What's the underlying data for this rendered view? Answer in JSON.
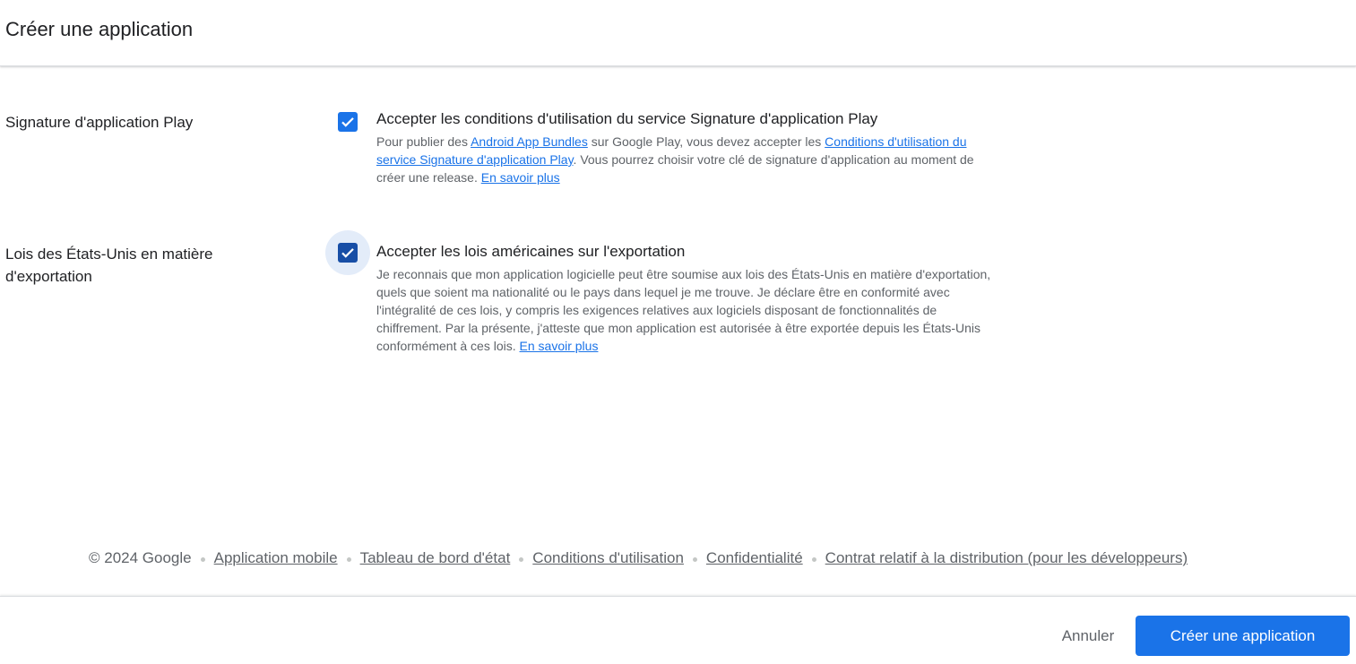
{
  "header": {
    "title": "Créer une application"
  },
  "sections": {
    "signing": {
      "label": "Signature d'application Play",
      "checked": true,
      "title": "Accepter les conditions d'utilisation du service Signature d'application Play",
      "desc_1": "Pour publier des ",
      "link_bundles": "Android App Bundles",
      "desc_2": " sur Google Play, vous devez accepter les ",
      "link_terms": "Conditions d'utilisation du service Signature d'application Play",
      "desc_3": ". Vous pourrez choisir votre clé de signature d'application au moment de créer une release. ",
      "link_learn": "En savoir plus"
    },
    "export": {
      "label": "Lois des États-Unis en matière d'exportation",
      "checked": true,
      "title": "Accepter les lois américaines sur l'exportation",
      "desc": "Je reconnais que mon application logicielle peut être soumise aux lois des États-Unis en matière d'exportation, quels que soient ma nationalité ou le pays dans lequel je me trouve. Je déclare être en conformité avec l'intégralité de ces lois, y compris les exigences relatives aux logiciels disposant de fonctionnalités de chiffrement. Par la présente, j'atteste que mon application est autorisée à être exportée depuis les États-Unis conformément à ces lois. ",
      "link_learn": "En savoir plus"
    }
  },
  "footer": {
    "copyright": "© 2024 Google",
    "links": [
      "Application mobile",
      "Tableau de bord d'état",
      "Conditions d'utilisation",
      "Confidentialité",
      "Contrat relatif à la distribution (pour les développeurs)"
    ]
  },
  "actions": {
    "cancel": "Annuler",
    "create": "Créer une application"
  },
  "colors": {
    "primary": "#1a73e8",
    "checkbox_focused": "#174ea6"
  }
}
